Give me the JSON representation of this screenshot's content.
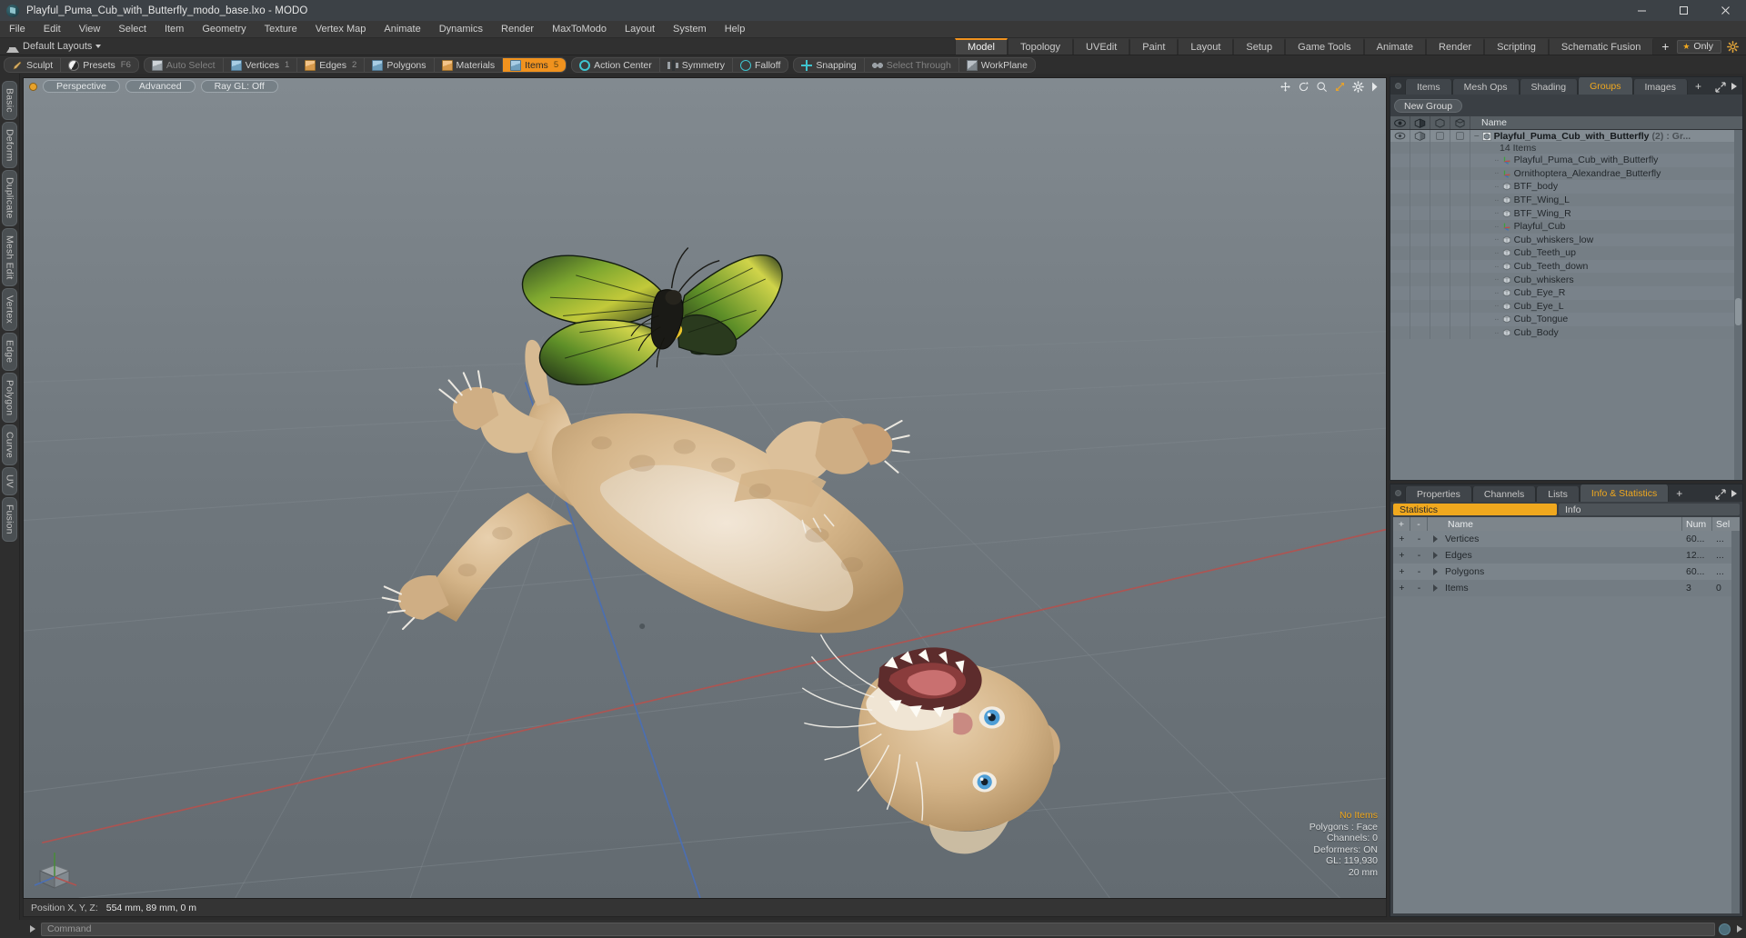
{
  "window": {
    "title": "Playful_Puma_Cub_with_Butterfly_modo_base.lxo - MODO",
    "minimize": "–",
    "maximize": "□",
    "close": "✕"
  },
  "menubar": {
    "items": [
      "File",
      "Edit",
      "View",
      "Select",
      "Item",
      "Geometry",
      "Texture",
      "Vertex Map",
      "Animate",
      "Dynamics",
      "Render",
      "MaxToModo",
      "Layout",
      "System",
      "Help"
    ]
  },
  "layoutbar": {
    "layouts_label": "Default Layouts",
    "tabs": [
      {
        "label": "Model",
        "active": true
      },
      {
        "label": "Topology",
        "active": false
      },
      {
        "label": "UVEdit",
        "active": false
      },
      {
        "label": "Paint",
        "active": false
      },
      {
        "label": "Layout",
        "active": false
      },
      {
        "label": "Setup",
        "active": false
      },
      {
        "label": "Game Tools",
        "active": false
      },
      {
        "label": "Animate",
        "active": false
      },
      {
        "label": "Render",
        "active": false
      },
      {
        "label": "Scripting",
        "active": false
      },
      {
        "label": "Schematic Fusion",
        "active": false
      }
    ],
    "plus": "+",
    "only_label": "Only"
  },
  "modebar": {
    "groups": [
      {
        "buttons": [
          {
            "label": "Sculpt",
            "icon": "brush-icon",
            "num": "",
            "state": "normal"
          },
          {
            "label": "Presets",
            "icon": "sphere-icon",
            "num": "F6",
            "state": "normal"
          }
        ]
      },
      {
        "buttons": [
          {
            "label": "Auto Select",
            "icon": "cube-grey-icon",
            "num": "",
            "state": "dim"
          },
          {
            "label": "Vertices",
            "icon": "cube-blue-icon",
            "num": "1",
            "state": "normal"
          },
          {
            "label": "Edges",
            "icon": "cube-orange-icon",
            "num": "2",
            "state": "normal"
          },
          {
            "label": "Polygons",
            "icon": "cube-blue-icon",
            "num": "",
            "state": "normal"
          },
          {
            "label": "Materials",
            "icon": "cube-orange-icon",
            "num": "",
            "state": "normal"
          },
          {
            "label": "Items",
            "icon": "cube-blue-icon",
            "num": "5",
            "state": "active"
          }
        ]
      },
      {
        "buttons": [
          {
            "label": "Action Center",
            "icon": "action-center-icon",
            "num": "",
            "state": "normal"
          },
          {
            "label": "Symmetry",
            "icon": "symmetry-icon",
            "num": "",
            "state": "normal"
          },
          {
            "label": "Falloff",
            "icon": "falloff-icon",
            "num": "",
            "state": "normal"
          }
        ]
      },
      {
        "buttons": [
          {
            "label": "Snapping",
            "icon": "snapping-icon",
            "num": "",
            "state": "normal"
          },
          {
            "label": "Select Through",
            "icon": "select-through-icon",
            "num": "",
            "state": "dim"
          },
          {
            "label": "WorkPlane",
            "icon": "workplane-icon",
            "num": "",
            "state": "normal"
          }
        ]
      }
    ]
  },
  "leftrail": {
    "tabs": [
      "Basic",
      "Deform",
      "Duplicate",
      "Mesh Edit",
      "Vertex",
      "Edge",
      "Polygon",
      "Curve",
      "UV",
      "Fusion"
    ]
  },
  "viewport": {
    "buttons": [
      "Perspective",
      "Advanced",
      "Ray GL: Off"
    ],
    "tools": [
      "move-icon",
      "rotate-icon",
      "zoom-icon",
      "fit-icon",
      "gear-icon",
      "chevron-right-icon"
    ],
    "stats": {
      "selection": "No Items",
      "polygons": "Polygons : Face",
      "channels": "Channels: 0",
      "deformers": "Deformers: ON",
      "gl": "GL: 119,930",
      "grid": "20 mm"
    }
  },
  "statusbar": {
    "position_label": "Position X, Y, Z:",
    "position_value": "554 mm, 89 mm, 0 m"
  },
  "itemspanel": {
    "tabs": [
      {
        "label": "Items",
        "active": false
      },
      {
        "label": "Mesh Ops",
        "active": false
      },
      {
        "label": "Shading",
        "active": false
      },
      {
        "label": "Groups",
        "active": true
      },
      {
        "label": "Images",
        "active": false
      }
    ],
    "plus": "+",
    "new_group": "New Group",
    "columns": [
      "eye-icon",
      "shading-icon",
      "wire-cube-icon",
      "wire-cube-alt-icon"
    ],
    "name_column": "Name",
    "root": {
      "name": "Playful_Puma_Cub_with_Butterfly",
      "count": "(2)",
      "type": ": Gr...",
      "subtitle": "14 Items"
    },
    "items": [
      {
        "name": "Playful_Puma_Cub_with_Butterfly",
        "icon": "axis-icon"
      },
      {
        "name": "Ornithoptera_Alexandrae_Butterfly",
        "icon": "axis-icon"
      },
      {
        "name": "BTF_body",
        "icon": "mesh-icon"
      },
      {
        "name": "BTF_Wing_L",
        "icon": "mesh-icon"
      },
      {
        "name": "BTF_Wing_R",
        "icon": "mesh-icon"
      },
      {
        "name": "Playful_Cub",
        "icon": "axis-icon"
      },
      {
        "name": "Cub_whiskers_low",
        "icon": "mesh-icon"
      },
      {
        "name": "Cub_Teeth_up",
        "icon": "mesh-icon"
      },
      {
        "name": "Cub_Teeth_down",
        "icon": "mesh-icon"
      },
      {
        "name": "Cub_whiskers",
        "icon": "mesh-icon"
      },
      {
        "name": "Cub_Eye_R",
        "icon": "mesh-icon"
      },
      {
        "name": "Cub_Eye_L",
        "icon": "mesh-icon"
      },
      {
        "name": "Cub_Tongue",
        "icon": "mesh-icon"
      },
      {
        "name": "Cub_Body",
        "icon": "mesh-icon"
      }
    ]
  },
  "infopanel": {
    "tabs": [
      {
        "label": "Properties",
        "active": false
      },
      {
        "label": "Channels",
        "active": false
      },
      {
        "label": "Lists",
        "active": false
      },
      {
        "label": "Info & Statistics",
        "active": true
      }
    ],
    "plus": "+",
    "subtabs": [
      {
        "label": "Statistics",
        "active": true
      },
      {
        "label": "Info",
        "active": false
      }
    ],
    "columns": {
      "plus": "+",
      "minus": "-",
      "name": "Name",
      "num": "Num",
      "sel": "Sel"
    },
    "rows": [
      {
        "name": "Vertices",
        "num": "60...",
        "sel": "..."
      },
      {
        "name": "Edges",
        "num": "12...",
        "sel": "..."
      },
      {
        "name": "Polygons",
        "num": "60...",
        "sel": "..."
      },
      {
        "name": "Items",
        "num": "3",
        "sel": "0"
      }
    ]
  },
  "commandbar": {
    "placeholder": "Command"
  },
  "colors": {
    "accent": "#f0a81e",
    "panel": "#3a3f44",
    "list": "#767f86",
    "titlebar": "#3c4146"
  }
}
